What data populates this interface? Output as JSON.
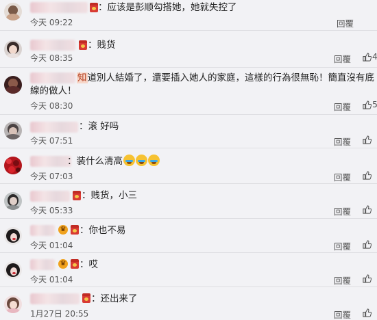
{
  "comments": [
    {
      "text": "：应该是彭顺勾搭她，她就失控了",
      "time": "今天 09:22",
      "reply": "回覆",
      "likes": ""
    },
    {
      "text": "：贱货",
      "time": "今天 08:35",
      "reply": "回覆",
      "likes": "4"
    },
    {
      "highlight": "知",
      "text": "道別人結婚了，還要插入她人的家庭，這樣的行為很無恥！簡直沒有底線的做人！",
      "time": "今天 08:30",
      "reply": "回覆",
      "likes": "5"
    },
    {
      "text": "：滚 好吗",
      "time": "今天 07:51",
      "reply": "回覆",
      "likes": ""
    },
    {
      "text": "：装什么清高",
      "time": "今天 07:03",
      "reply": "回覆",
      "likes": ""
    },
    {
      "text": "：贱货，小三",
      "time": "今天 05:33",
      "reply": "回覆",
      "likes": ""
    },
    {
      "text": "：你也不易",
      "time": "今天 01:04",
      "reply": "回覆",
      "likes": ""
    },
    {
      "text": "：哎",
      "time": "今天 01:04",
      "reply": "回覆",
      "likes": ""
    },
    {
      "text": "：还出来了",
      "time": "1月27日 20:55",
      "reply": "回覆",
      "likes": ""
    }
  ],
  "icons": {
    "like": "thumbs-up-icon",
    "red_packet": "red-packet-icon",
    "emoji_badge": "crown-emoji-icon",
    "crying_emoji": "crying-laughing-emoji-icon"
  },
  "colors": {
    "background": "#f2f2f5",
    "divider": "#dedee2",
    "text": "#222222",
    "meta": "#555555"
  }
}
